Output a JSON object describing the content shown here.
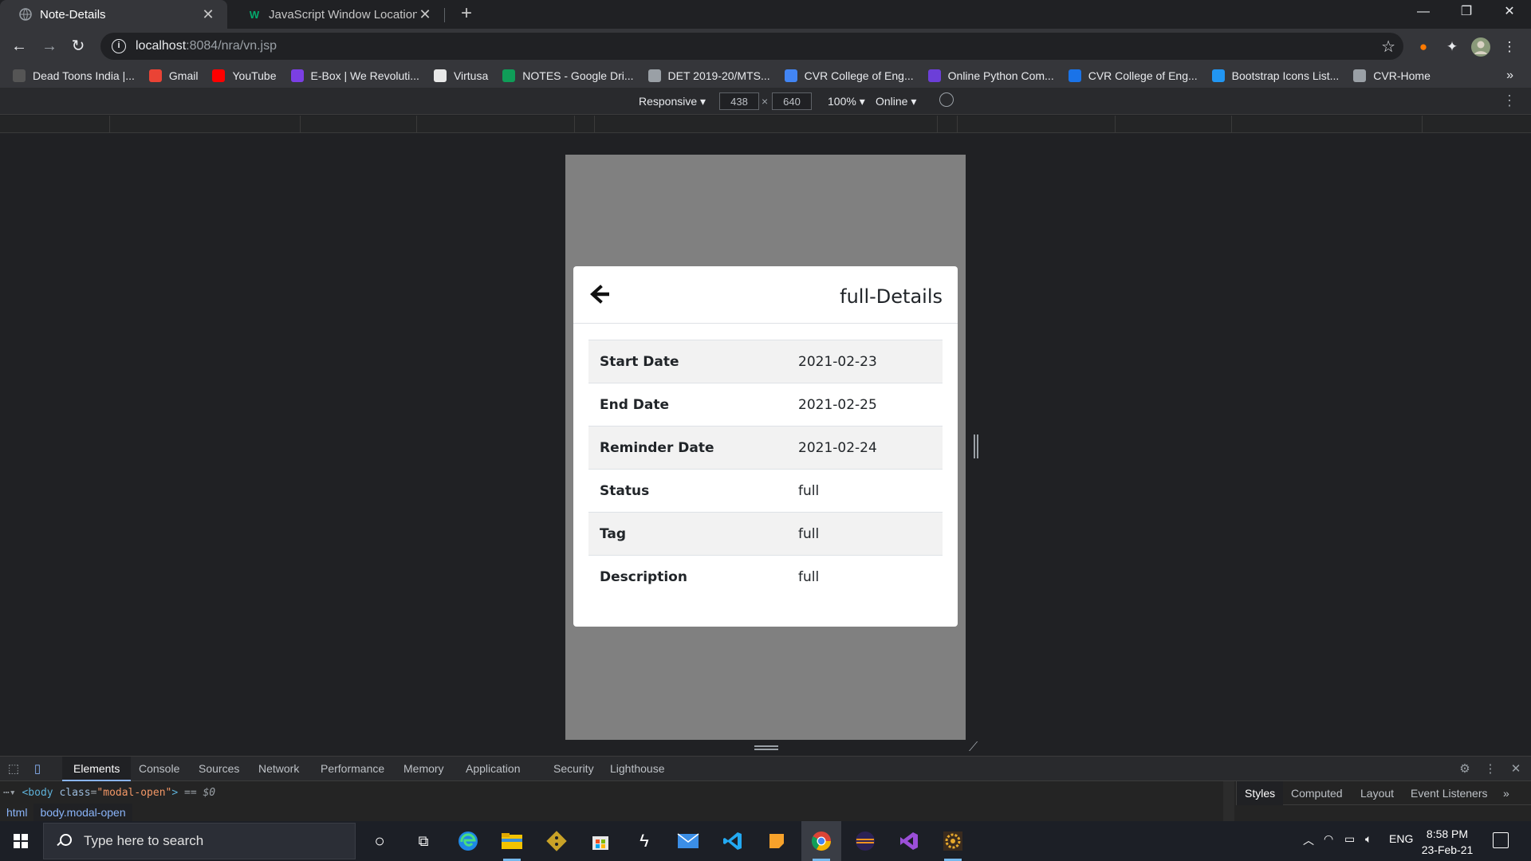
{
  "browser": {
    "tabs": [
      {
        "title": "Note-Details",
        "active": true
      },
      {
        "title": "JavaScript Window Location",
        "active": false
      }
    ],
    "new_tab": "+",
    "url_host": "localhost",
    "url_rest": ":8084/nra/vn.jsp",
    "bookmarks": [
      {
        "label": "Dead Toons India |...",
        "icon": "dead-toons-icon",
        "color": "#555555"
      },
      {
        "label": "Gmail",
        "icon": "gmail-icon",
        "color": "#ea4335"
      },
      {
        "label": "YouTube",
        "icon": "youtube-icon",
        "color": "#ff0000"
      },
      {
        "label": "E-Box | We Revoluti...",
        "icon": "ebox-icon",
        "color": "#7b3fe4"
      },
      {
        "label": "Virtusa",
        "icon": "virtusa-icon",
        "color": "#e8e8e8"
      },
      {
        "label": "NOTES - Google Dri...",
        "icon": "google-drive-icon",
        "color": "#0f9d58"
      },
      {
        "label": "DET 2019-20/MTS...",
        "icon": "globe-icon",
        "color": "#9aa0a6"
      },
      {
        "label": "CVR College of Eng...",
        "icon": "cvr-link-icon",
        "color": "#4285f4"
      },
      {
        "label": "Online Python Com...",
        "icon": "python-compiler-icon",
        "color": "#6c3fd8"
      },
      {
        "label": "CVR College of Eng...",
        "icon": "cvr-c-icon",
        "color": "#1a73e8"
      },
      {
        "label": "Bootstrap Icons List...",
        "icon": "mdi-icon",
        "color": "#2196f3"
      },
      {
        "label": "CVR-Home",
        "icon": "globe-icon",
        "color": "#9aa0a6"
      }
    ],
    "bookmarks_more": "»"
  },
  "device_toolbar": {
    "mode": "Responsive",
    "width": "438",
    "height": "640",
    "times": "×",
    "zoom": "100%",
    "network": "Online"
  },
  "modal": {
    "title": "full-Details",
    "rows": [
      {
        "label": "Start Date",
        "value": "2021-02-23"
      },
      {
        "label": "End Date",
        "value": "2021-02-25"
      },
      {
        "label": "Reminder Date",
        "value": "2021-02-24"
      },
      {
        "label": "Status",
        "value": "full"
      },
      {
        "label": "Tag",
        "value": "full"
      },
      {
        "label": "Description",
        "value": "full"
      }
    ]
  },
  "devtools": {
    "tabs": [
      "Elements",
      "Console",
      "Sources",
      "Network",
      "Performance",
      "Memory",
      "Application",
      "Security",
      "Lighthouse"
    ],
    "active_tab": "Elements",
    "code": {
      "open": "<body",
      "attr": "class",
      "eq": "=",
      "val": "\"modal-open\"",
      "close": ">",
      "suffix": "== $0"
    },
    "breadcrumbs": [
      "html",
      "body.modal-open"
    ],
    "side_tabs": [
      "Styles",
      "Computed",
      "Layout",
      "Event Listeners"
    ],
    "side_more": "»"
  },
  "taskbar": {
    "search_placeholder": "Type here to search",
    "language": "ENG",
    "time": "8:58 PM",
    "date": "23-Feb-21"
  },
  "colors": {
    "browser_dark": "#202124",
    "toolbar": "#35363a",
    "overlay_gray": "#808080",
    "accent_blue": "#8ab4f8"
  }
}
